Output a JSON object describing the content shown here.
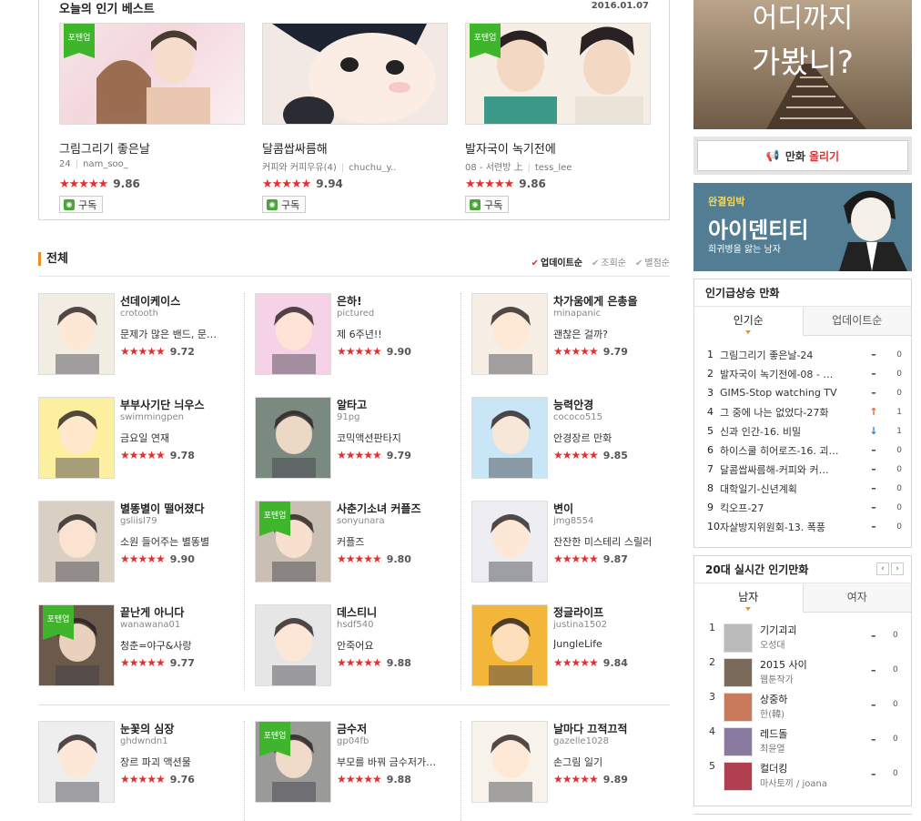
{
  "best": {
    "title": "오늘의 인기 베스트",
    "date": "2016.01.07",
    "cards": [
      {
        "title": "그림그리기 좋은날",
        "meta1": "24",
        "meta2": "nam_soo_",
        "stars": "★★★★★",
        "score": "9.86",
        "badge": "포텐업",
        "subscribe": "구독"
      },
      {
        "title": "달콤쌉싸름해",
        "meta1": "커피와 커피우유(4)",
        "meta2": "chuchu_y..",
        "stars": "★★★★★",
        "score": "9.94",
        "badge": "",
        "subscribe": "구독"
      },
      {
        "title": "발자국이 녹기전에",
        "meta1": "08 - 서련방 上",
        "meta2": "tess_lee",
        "stars": "★★★★★",
        "score": "9.86",
        "badge": "포텐업",
        "subscribe": "구독"
      }
    ]
  },
  "all": {
    "title": "전체",
    "sort": [
      "업데이트순",
      "조회순",
      "별점순"
    ],
    "items": [
      {
        "name": "선데이케이스",
        "author": "crotooth",
        "desc": "문제가 많은 밴드, 문…",
        "stars": "★★★★★",
        "score": "9.72",
        "badge": ""
      },
      {
        "name": "은하!",
        "author": "pictured",
        "desc": "제 6주년!!",
        "stars": "★★★★★",
        "score": "9.90",
        "badge": ""
      },
      {
        "name": "차가움에게 은총을",
        "author": "minapanic",
        "desc": "괜찮은 걸까?",
        "stars": "★★★★★",
        "score": "9.79",
        "badge": ""
      },
      {
        "name": "부부사기단 늬우스",
        "author": "swimmingpen",
        "desc": "금요일 연재",
        "stars": "★★★★★",
        "score": "9.78",
        "badge": ""
      },
      {
        "name": "알타고",
        "author": "91pg",
        "desc": "코믹액션판타지",
        "stars": "★★★★★",
        "score": "9.79",
        "badge": ""
      },
      {
        "name": "능력안경",
        "author": "cococo515",
        "desc": "안경장르 만화",
        "stars": "★★★★★",
        "score": "9.85",
        "badge": ""
      },
      {
        "name": "별똥별이 떨어졌다",
        "author": "gsliisl79",
        "desc": "소원 들어주는 별똥별",
        "stars": "★★★★★",
        "score": "9.90",
        "badge": ""
      },
      {
        "name": "사춘기소녀 커플즈",
        "author": "sonyunara",
        "desc": "커플즈",
        "stars": "★★★★★",
        "score": "9.80",
        "badge": "포텐업"
      },
      {
        "name": "변이",
        "author": "jmg8554",
        "desc": "잔잔한 미스테리 스릴러",
        "stars": "★★★★★",
        "score": "9.87",
        "badge": ""
      },
      {
        "name": "끝난게 아니다",
        "author": "wanawana01",
        "desc": "청춘=야구&사랑",
        "stars": "★★★★★",
        "score": "9.77",
        "badge": "포텐업"
      },
      {
        "name": "데스티니",
        "author": "hsdf540",
        "desc": "안죽어요",
        "stars": "★★★★★",
        "score": "9.88",
        "badge": ""
      },
      {
        "name": "정글라이프",
        "author": "justina1502",
        "desc": "JungleLife",
        "stars": "★★★★★",
        "score": "9.84",
        "badge": ""
      },
      {
        "name": "눈꽃의 심장",
        "author": "ghdwndn1",
        "desc": "장르 파괴 액션물",
        "stars": "★★★★★",
        "score": "9.76",
        "badge": ""
      },
      {
        "name": "금수저",
        "author": "gp04fb",
        "desc": "부모를 바꿔 금수저가…",
        "stars": "★★★★★",
        "score": "9.88",
        "badge": "포텐업"
      },
      {
        "name": "날마다 끄적끄적",
        "author": "gazelle1028",
        "desc": "손그림 일기",
        "stars": "★★★★★",
        "score": "9.89",
        "badge": ""
      }
    ]
  },
  "side": {
    "ad_text_1": "어디까지",
    "ad_text_2": "가봤니?",
    "upload_label": "만화",
    "upload_hl": "올리기",
    "banner": {
      "tag": "완결임박",
      "title": "아이덴티티",
      "sub": "희귀병을 앓는 남자"
    },
    "rising": {
      "title": "인기급상승 만화",
      "tabs": [
        "인기순",
        "업데이트순"
      ],
      "rows": [
        {
          "n": "1",
          "t": "그림그리기 좋은날-24",
          "ch": "–",
          "cv": "0",
          "color": "#333"
        },
        {
          "n": "2",
          "t": "발자국이 녹기전에-08 - …",
          "ch": "–",
          "cv": "0",
          "color": "#333"
        },
        {
          "n": "3",
          "t": "GIMS-Stop watching TV",
          "ch": "–",
          "cv": "0",
          "color": "#333"
        },
        {
          "n": "4",
          "t": "그 중에 나는 없었다-27화",
          "ch": "↑",
          "cv": "1",
          "color": "#e8632b"
        },
        {
          "n": "5",
          "t": "신과 인간-16. 비밀",
          "ch": "↓",
          "cv": "1",
          "color": "#2a7fd4"
        },
        {
          "n": "6",
          "t": "하이스쿨 히어로즈-16. 괴…",
          "ch": "–",
          "cv": "0",
          "color": "#333"
        },
        {
          "n": "7",
          "t": "달콤쌉싸름해-커피와 커…",
          "ch": "–",
          "cv": "0",
          "color": "#333"
        },
        {
          "n": "8",
          "t": "대학일기-신년계획",
          "ch": "–",
          "cv": "0",
          "color": "#333"
        },
        {
          "n": "9",
          "t": "킥오프-27",
          "ch": "–",
          "cv": "0",
          "color": "#333"
        },
        {
          "n": "10",
          "t": "자살방지위원회-13. 폭풍",
          "ch": "–",
          "cv": "0",
          "color": "#333"
        }
      ]
    },
    "realtime": {
      "title": "20대 실시간 인기만화",
      "tabs": [
        "남자",
        "여자"
      ],
      "rows": [
        {
          "n": "1",
          "t1": "기기괴괴",
          "t2": "오성대",
          "ch": "–",
          "cv": "0"
        },
        {
          "n": "2",
          "t1": "2015 사이",
          "t2": "웹툰작가",
          "ch": "–",
          "cv": "0"
        },
        {
          "n": "3",
          "t1": "상중하",
          "t2": "한(韓)",
          "ch": "–",
          "cv": "0"
        },
        {
          "n": "4",
          "t1": "레드돌",
          "t2": "최윤열",
          "ch": "–",
          "cv": "0"
        },
        {
          "n": "5",
          "t1": "컬더킹",
          "t2": "마사토끼 / joana",
          "ch": "–",
          "cv": "0"
        }
      ]
    }
  }
}
